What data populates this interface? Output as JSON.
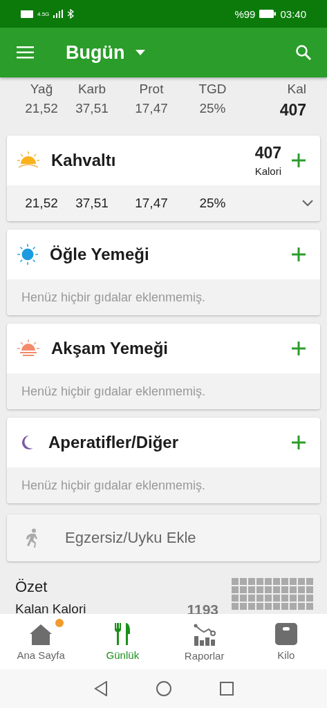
{
  "status_bar": {
    "network": "4.5G",
    "battery": "%99",
    "time": "03:40"
  },
  "app_bar": {
    "title": "Bugün"
  },
  "totals": {
    "columns": [
      {
        "label": "Yağ",
        "value": "21,52"
      },
      {
        "label": "Karb",
        "value": "37,51"
      },
      {
        "label": "Prot",
        "value": "17,47"
      },
      {
        "label": "TGD",
        "value": "25%"
      },
      {
        "label": "Kal",
        "value": "407"
      }
    ]
  },
  "meals": [
    {
      "kind": "sunrise",
      "name": "Kahvaltı",
      "calories": "407",
      "calories_label": "Kalori",
      "expanded": true,
      "macros": [
        "21,52",
        "37,51",
        "17,47",
        "25%"
      ]
    },
    {
      "kind": "sun",
      "name": "Öğle Yemeği",
      "empty_text": "Henüz hiçbir gıdalar eklenmemiş."
    },
    {
      "kind": "sunset",
      "name": "Akşam Yemeği",
      "empty_text": "Henüz hiçbir gıdalar eklenmemiş."
    },
    {
      "kind": "moon",
      "name": "Aperatifler/Diğer",
      "empty_text": "Henüz hiçbir gıdalar eklenmemiş."
    }
  ],
  "exercise": {
    "label": "Egzersiz/Uyku Ekle"
  },
  "summary": {
    "title": "Özet",
    "row_label": "Kalan Kalori",
    "row_value": "1193"
  },
  "bottom_nav": [
    {
      "kind": "home",
      "label": "Ana Sayfa",
      "selected": false,
      "badge": true
    },
    {
      "kind": "diary",
      "label": "Günlük",
      "selected": true,
      "badge": false
    },
    {
      "kind": "reports",
      "label": "Raporlar",
      "selected": false,
      "badge": false
    },
    {
      "kind": "scale",
      "label": "Kilo",
      "selected": false,
      "badge": false
    }
  ]
}
